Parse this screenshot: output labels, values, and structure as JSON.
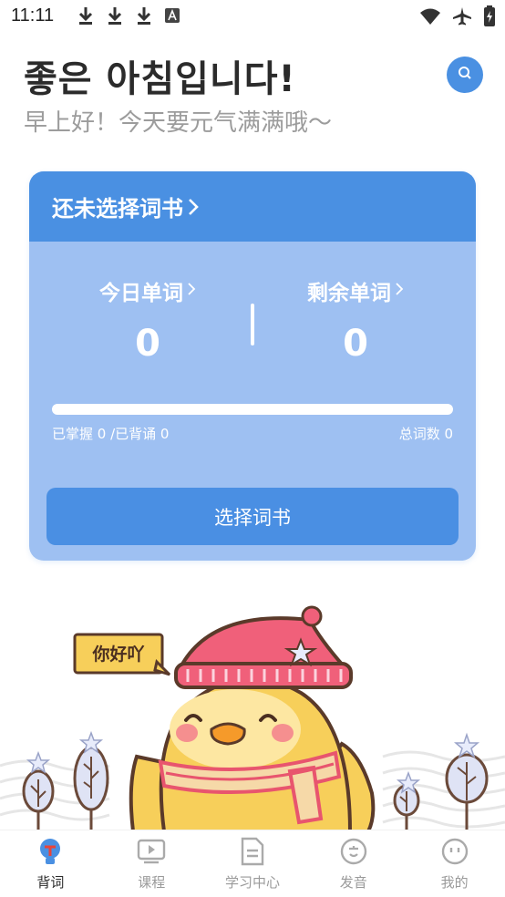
{
  "status_bar": {
    "time": "11:11",
    "left_icons": [
      "download-icon",
      "download-icon",
      "download-icon",
      "keyboard-a-icon"
    ],
    "right_icons": [
      "wifi-icon",
      "airplane-mode-icon",
      "battery-charging-icon"
    ]
  },
  "header": {
    "greeting_ko": "좋은 아침입니다!",
    "greeting_cn": "早上好！今天要元气满满哦～",
    "search_icon": "search-icon"
  },
  "card": {
    "title": "还未选择词书",
    "today_label": "今日单词",
    "today_value": "0",
    "remaining_label": "剩余单词",
    "remaining_value": "0",
    "progress_fraction": 0,
    "mastered_text": "已掌握 0 /已背诵 0",
    "total_text": "总词数 0",
    "select_button": "选择词书"
  },
  "illustration": {
    "bubble_text": "你好吖"
  },
  "bottom_nav": {
    "items": [
      {
        "label": "背词",
        "icon": "lightbulb-icon",
        "active": true
      },
      {
        "label": "课程",
        "icon": "video-play-icon",
        "active": false
      },
      {
        "label": "学习中心",
        "icon": "document-icon",
        "active": false
      },
      {
        "label": "发音",
        "icon": "speech-bubble-icon",
        "active": false
      },
      {
        "label": "我的",
        "icon": "smiley-face-icon",
        "active": false
      }
    ]
  },
  "colors": {
    "accent": "#4a90e2",
    "card_body": "#9ec0f2",
    "hat_pink": "#f0607a",
    "duck_yellow": "#f7cf5a",
    "nav_active_red": "#e8443a"
  }
}
